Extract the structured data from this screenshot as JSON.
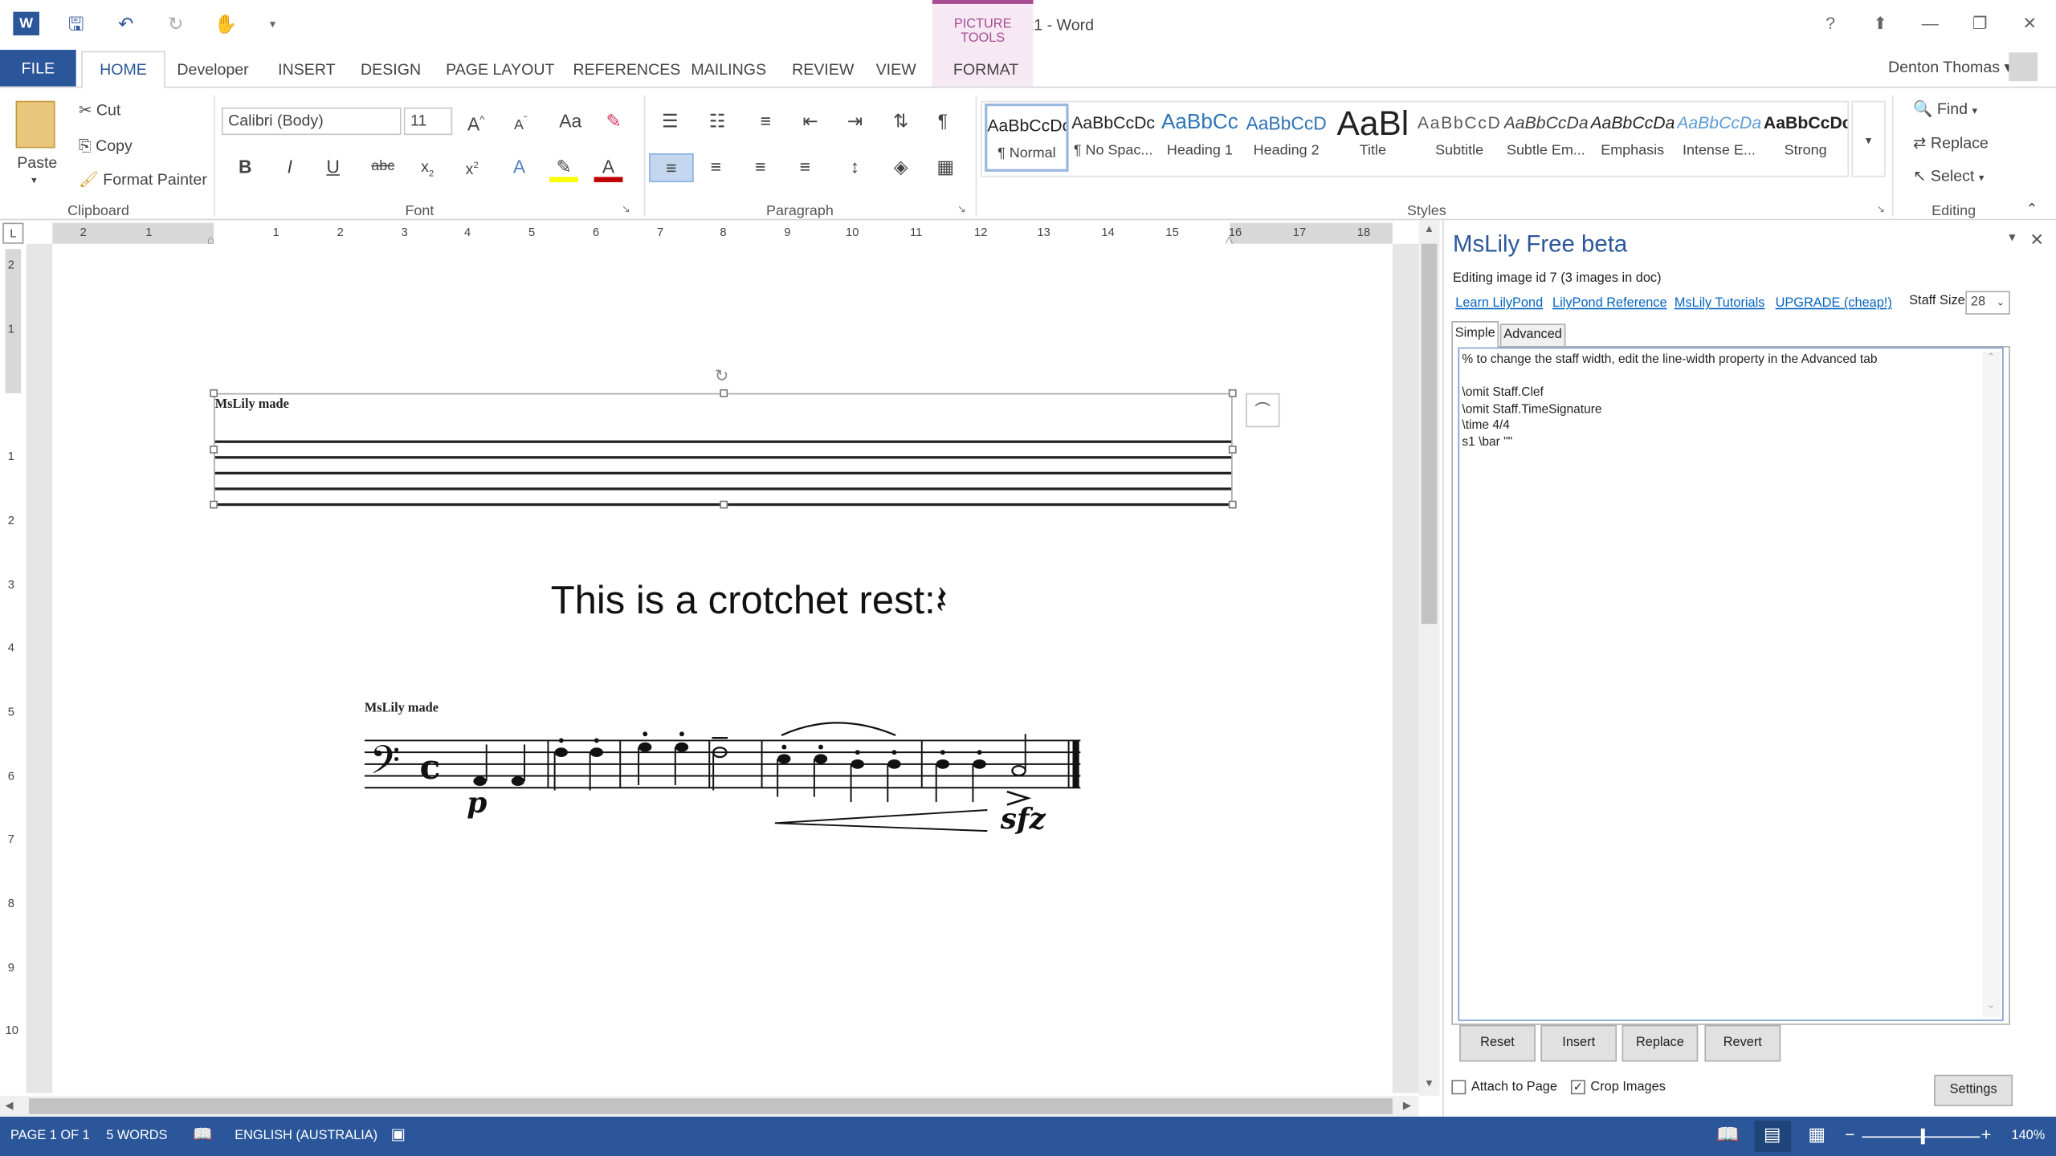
{
  "window": {
    "title": "Document1 - Word",
    "context_tab_group": "PICTURE TOOLS",
    "user": "Denton Thomas ▾",
    "help": "?"
  },
  "tabs": [
    "FILE",
    "HOME",
    "Developer",
    "INSERT",
    "DESIGN",
    "PAGE LAYOUT",
    "REFERENCES",
    "MAILINGS",
    "REVIEW",
    "VIEW",
    "FORMAT"
  ],
  "clipboard": {
    "paste": "Paste",
    "cut": "Cut",
    "copy": "Copy",
    "format_painter": "Format Painter",
    "label": "Clipboard"
  },
  "font": {
    "family": "Calibri (Body)",
    "size": "11",
    "label": "Font"
  },
  "paragraph": {
    "label": "Paragraph"
  },
  "styles": {
    "label": "Styles",
    "items": [
      {
        "preview": "AaBbCcDc",
        "name": "¶ Normal"
      },
      {
        "preview": "AaBbCcDc",
        "name": "¶ No Spac..."
      },
      {
        "preview": "AaBbCc",
        "name": "Heading 1"
      },
      {
        "preview": "AaBbCcD",
        "name": "Heading 2"
      },
      {
        "preview": "AaBl",
        "name": "Title"
      },
      {
        "preview": "AaBbCcD",
        "name": "Subtitle"
      },
      {
        "preview": "AaBbCcDa",
        "name": "Subtle Em..."
      },
      {
        "preview": "AaBbCcDa",
        "name": "Emphasis"
      },
      {
        "preview": "AaBbCcDa",
        "name": "Intense E..."
      },
      {
        "preview": "AaBbCcDc",
        "name": "Strong"
      }
    ]
  },
  "editing": {
    "find": "Find",
    "replace": "Replace",
    "select": "Select",
    "label": "Editing"
  },
  "ruler": {
    "h_left": [
      "2",
      "1"
    ],
    "h_right": [
      "1",
      "2",
      "3",
      "4",
      "5",
      "6",
      "7",
      "8",
      "9",
      "10",
      "11",
      "12",
      "13",
      "14",
      "15",
      "16",
      "17",
      "18"
    ],
    "v": [
      "2",
      "1",
      "1",
      "2",
      "3",
      "4",
      "5",
      "6",
      "7",
      "8",
      "9",
      "10"
    ]
  },
  "document": {
    "image1_caption": "MsLily made",
    "crotchet_text": "This is a crotchet rest:",
    "image2_caption": "MsLily made",
    "dynamic_p": "p",
    "dynamic_sfz": "sfz"
  },
  "pane": {
    "title": "MsLily Free beta",
    "info": "Editing image id 7 (3 images in doc)",
    "links": [
      "Learn LilyPond",
      "LilyPond Reference",
      "MsLily Tutorials",
      "UPGRADE (cheap!)"
    ],
    "staff_size_label": "Staff Size",
    "staff_size": "28",
    "tabs": [
      "Simple",
      "Advanced"
    ],
    "code": "% to change the staff width, edit the line-width property in the Advanced tab\n\n\\omit Staff.Clef\n\\omit Staff.TimeSignature\n\\time 4/4\ns1 \\bar \"\"",
    "buttons": [
      "Reset",
      "Insert",
      "Replace",
      "Revert"
    ],
    "attach_to_page": "Attach to Page",
    "crop_images": "Crop Images",
    "settings": "Settings"
  },
  "status": {
    "page": "PAGE 1 OF 1",
    "words": "5 WORDS",
    "language": "ENGLISH (AUSTRALIA)",
    "zoom": "140%"
  }
}
